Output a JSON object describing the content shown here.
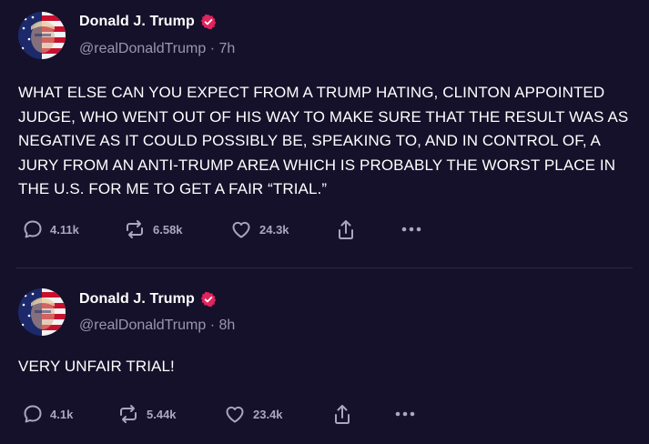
{
  "colors": {
    "background": "#15112a",
    "text": "#ffffff",
    "muted": "#9a96ad",
    "verified_badge": "#e0245e",
    "icon": "#aaa6bd"
  },
  "posts": [
    {
      "author": "Donald J. Trump",
      "handle": "@realDonaldTrump",
      "separator": "·",
      "time": "7h",
      "text": "WHAT ELSE CAN YOU EXPECT FROM A TRUMP HATING, CLINTON APPOINTED JUDGE, WHO WENT OUT OF HIS WAY TO MAKE SURE THAT THE RESULT WAS AS NEGATIVE AS IT COULD POSSIBLY BE, SPEAKING TO, AND IN CONTROL OF, A JURY FROM AN ANTI-TRUMP AREA WHICH IS PROBABLY THE WORST PLACE IN THE U.S. FOR ME TO GET A FAIR “TRIAL.”",
      "replies": "4.11k",
      "reposts": "6.58k",
      "likes": "24.3k",
      "icons": [
        "reply-icon",
        "repost-icon",
        "like-icon",
        "share-icon",
        "more-icon"
      ]
    },
    {
      "author": "Donald J. Trump",
      "handle": "@realDonaldTrump",
      "separator": "·",
      "time": "8h",
      "text": "VERY UNFAIR TRIAL!",
      "replies": "4.1k",
      "reposts": "5.44k",
      "likes": "23.4k",
      "icons": [
        "reply-icon",
        "repost-icon",
        "like-icon",
        "share-icon",
        "more-icon"
      ]
    }
  ]
}
